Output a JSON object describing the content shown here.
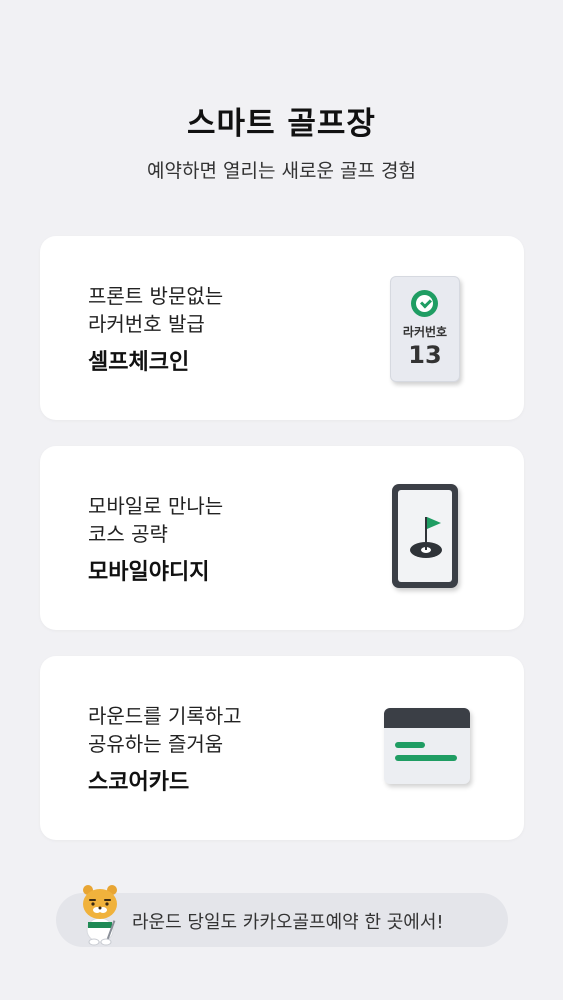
{
  "header": {
    "title": "스마트 골프장",
    "subtitle": "예약하면 열리는 새로운 골프 경험"
  },
  "cards": [
    {
      "line1": "프론트 방문없는",
      "line2": "라커번호 발급",
      "name": "셀프체크인",
      "icon": "locker-card-icon",
      "locker_label": "라커번호",
      "locker_number": "13"
    },
    {
      "line1": "모바일로 만나는",
      "line2": "코스 공략",
      "name": "모바일야디지",
      "icon": "phone-golf-flag-icon"
    },
    {
      "line1": "라운드를 기록하고",
      "line2": "공유하는 즐거움",
      "name": "스코어카드",
      "icon": "scorecard-icon"
    }
  ],
  "footer": {
    "text": "라운드 당일도 카카오골프예약 한 곳에서!",
    "mascot": "ryan-golfer-mascot"
  },
  "colors": {
    "background": "#f1f1f4",
    "card": "#ffffff",
    "accent_green": "#1f9d63",
    "dark": "#3b3f46"
  }
}
